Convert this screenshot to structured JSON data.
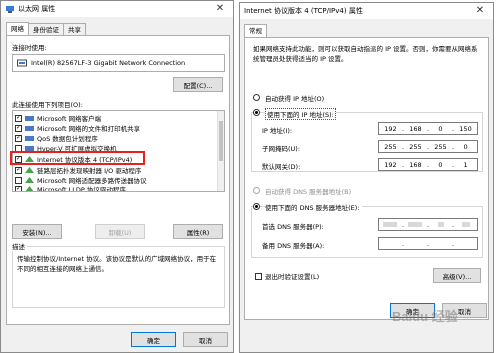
{
  "ethernet_window": {
    "title": "以太网 属性",
    "tabs": [
      "网络",
      "身份验证",
      "共享"
    ],
    "connect_using_label": "连接时使用:",
    "adapter_name": "Intel(R) 82567LF-3 Gigabit Network Connection",
    "configure_button": "配置(C)...",
    "items_label": "此连接使用下列项目(O):",
    "items": [
      "Microsoft 网络客户端",
      "Microsoft 网络的文件和打印机共享",
      "QoS 数据包计划程序",
      "Hyper-V 可扩展虚拟交换机",
      "Internet 协议版本 4 (TCP/IPv4)",
      "链路层拓扑发现映射器 I/O 驱动程序",
      "Microsoft 网络适配器多路传送器协议",
      "Microsoft LLDP 协议驱动程序"
    ],
    "item4_overlay": "Hyper-V 可扩展虚拟交换机",
    "install_button": "安装(N)...",
    "uninstall_button": "卸载(U)",
    "properties_button": "属性(R)",
    "description_label": "描述",
    "description_text": "传输控制协议/Internet 协议。该协议是默认的广域网络协议，用于在不同的相互连接的网络上通信。",
    "ok_button": "确定",
    "cancel_button": "取消"
  },
  "ipv4_window": {
    "title": "Internet 协议版本 4 (TCP/IPv4) 属性",
    "tab": "常规",
    "intro_text": "如果网络支持此功能，则可以获取自动指派的 IP 设置。否则，你需要从网络系统管理员处获得适当的 IP 设置。",
    "auto_ip_label": "自动获得 IP 地址(O)",
    "manual_ip_label": "使用下面的 IP 地址(S):",
    "ip_address_label": "IP 地址(I):",
    "ip_address": [
      "192",
      "168",
      "0",
      "150"
    ],
    "subnet_label": "子网掩码(U):",
    "subnet_mask": [
      "255",
      "255",
      "255",
      "0"
    ],
    "gateway_label": "默认网关(D):",
    "gateway": [
      "192",
      "168",
      "0",
      "1"
    ],
    "auto_dns_label": "自动获得 DNS 服务器地址(B)",
    "manual_dns_label": "使用下面的 DNS 服务器地址(E):",
    "preferred_dns_label": "首选 DNS 服务器(P):",
    "alternate_dns_label": "备用 DNS 服务器(A):",
    "validate_label": "退出时验证设置(L)",
    "advanced_button": "高级(V)...",
    "ok_button": "确定",
    "cancel_button": "取消"
  },
  "watermark": "Baidu 经验",
  "colors": {
    "highlight_box": "#e8211c",
    "accent": "#0078d7"
  }
}
